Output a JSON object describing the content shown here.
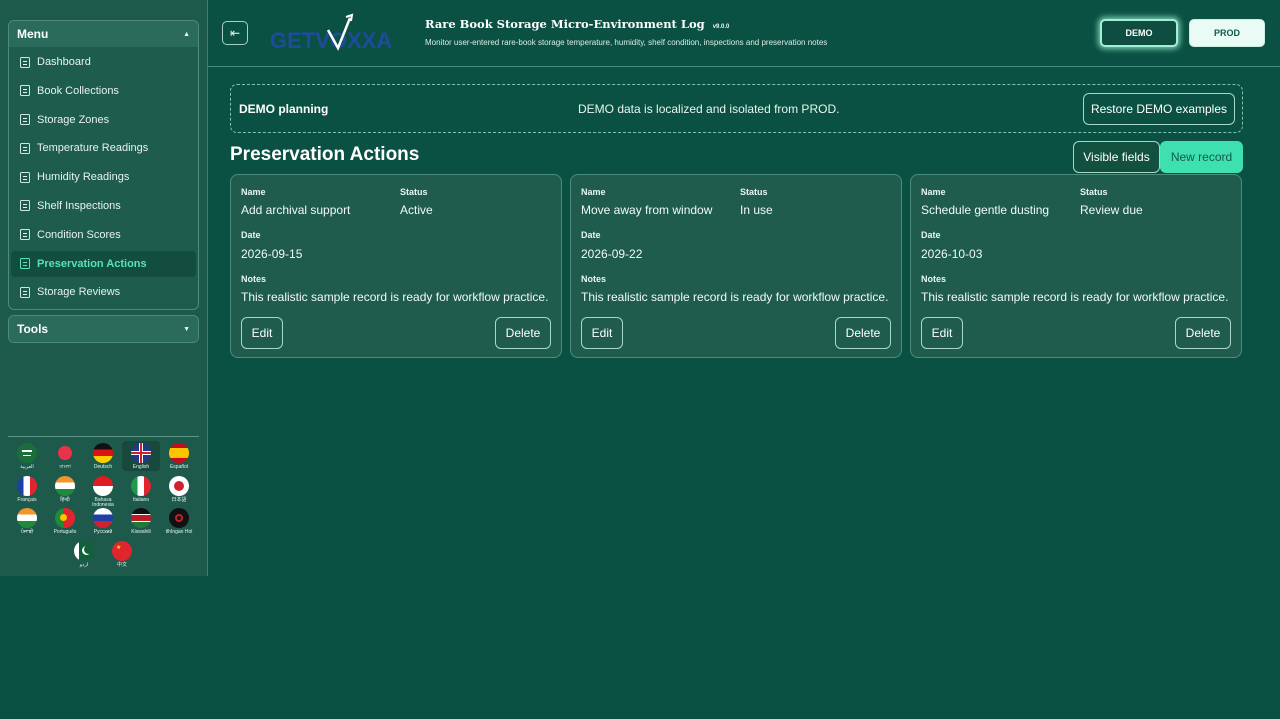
{
  "sidebar": {
    "menu_title": "Menu",
    "tools_title": "Tools",
    "items": [
      {
        "label": "Dashboard"
      },
      {
        "label": "Book Collections"
      },
      {
        "label": "Storage Zones"
      },
      {
        "label": "Temperature Readings"
      },
      {
        "label": "Humidity Readings"
      },
      {
        "label": "Shelf Inspections"
      },
      {
        "label": "Condition Scores"
      },
      {
        "label": "Preservation Actions",
        "active": true
      },
      {
        "label": "Storage Reviews"
      }
    ],
    "languages": [
      {
        "label": "العربية"
      },
      {
        "label": "বাংলা"
      },
      {
        "label": "Deutsch"
      },
      {
        "label": "English",
        "selected": true
      },
      {
        "label": "Español"
      },
      {
        "label": "Français"
      },
      {
        "label": "हिन्दी"
      },
      {
        "label": "Bahasa Indonesia"
      },
      {
        "label": "Italiano"
      },
      {
        "label": "日本語"
      },
      {
        "label": "ਪੰਜਾਬੀ"
      },
      {
        "label": "Português"
      },
      {
        "label": "Русский"
      },
      {
        "label": "Kiswahili"
      },
      {
        "label": "tlhIngan Hol"
      },
      {
        "label": "اردو"
      },
      {
        "label": "中文"
      }
    ]
  },
  "header": {
    "logo_text": "GETVOXXA",
    "title": "Rare Book Storage Micro-Environment Log",
    "version": "v9.0.0",
    "subtitle": "Monitor user-entered rare-book storage temperature, humidity, shelf condition, inspections and preservation notes",
    "demo_label": "DEMO",
    "prod_label": "PROD"
  },
  "banner": {
    "title": "DEMO planning",
    "message": "DEMO data is localized and isolated from PROD.",
    "restore_label": "Restore DEMO examples"
  },
  "section": {
    "title": "Preservation Actions",
    "visible_fields_label": "Visible fields",
    "new_record_label": "New record"
  },
  "field_labels": {
    "name": "Name",
    "status": "Status",
    "date": "Date",
    "notes": "Notes"
  },
  "records": [
    {
      "name": "Add archival support",
      "status": "Active",
      "date": "2026-09-15",
      "notes": "This realistic sample record is ready for workflow practice.",
      "edit": "Edit",
      "delete": "Delete"
    },
    {
      "name": "Move away from window",
      "status": "In use",
      "date": "2026-09-22",
      "notes": "This realistic sample record is ready for workflow practice.",
      "edit": "Edit",
      "delete": "Delete"
    },
    {
      "name": "Schedule gentle dusting",
      "status": "Review due",
      "date": "2026-10-03",
      "notes": "This realistic sample record is ready for workflow practice.",
      "edit": "Edit",
      "delete": "Delete"
    }
  ],
  "colors": {
    "accent": "#3fe0b0",
    "background": "#0b5143",
    "sidebar": "#1d5a4c"
  }
}
